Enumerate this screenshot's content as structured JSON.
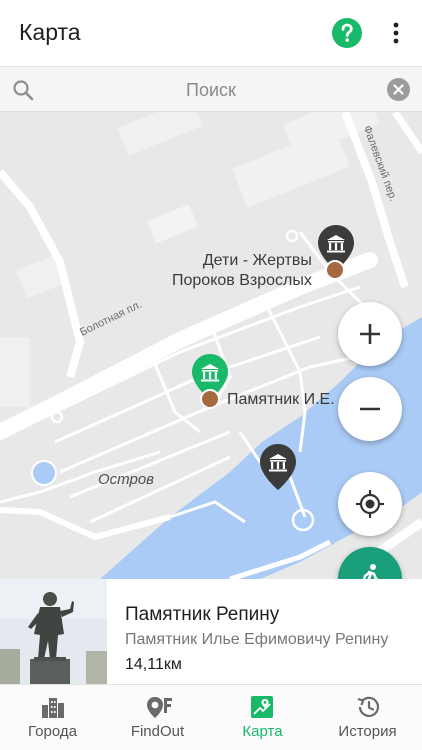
{
  "appbar": {
    "title": "Карта",
    "icons": {
      "help": "help-circle-icon",
      "more": "more-vertical-icon"
    },
    "help_color": "#19b96a"
  },
  "search": {
    "placeholder": "Поиск",
    "value": "",
    "icons": {
      "search": "search-icon",
      "clear": "clear-circle-icon"
    }
  },
  "map": {
    "places": [
      {
        "label": "Дети - Жертвы\nПороков Взрослых",
        "marker": "museum-pin-dark"
      },
      {
        "label": "Памятник И.Е.",
        "marker": "museum-pin-green"
      },
      {
        "label": "",
        "marker": "museum-pin-dark"
      }
    ],
    "area_labels": {
      "island": "Остров"
    },
    "street_labels": {
      "bolotnaya": "Болотная пл.",
      "falevsky": "Фалевский пер."
    },
    "controls": {
      "zoom_in": "plus-icon",
      "zoom_out": "minus-icon",
      "locate": "my-location-icon",
      "navigate": "walk-icon"
    },
    "colors": {
      "land": "#e8e8e8",
      "water": "#aacbf5",
      "road": "#ffffff",
      "marker_active": "#19b96a",
      "marker": "#3b3b3b",
      "poi_dot": "#a5683f"
    }
  },
  "card": {
    "title": "Памятник Репину",
    "subtitle": "Памятник Илье Ефимовичу Репину",
    "distance": "14,11км",
    "image": "repin-monument-photo"
  },
  "bottom_nav": {
    "items": [
      {
        "label": "Города",
        "icon": "city-icon",
        "active": false
      },
      {
        "label": "FindOut",
        "icon": "findout-icon",
        "active": false
      },
      {
        "label": "Карта",
        "icon": "map-icon",
        "active": true
      },
      {
        "label": "История",
        "icon": "history-icon",
        "active": false
      }
    ],
    "active_color": "#19b96a"
  }
}
